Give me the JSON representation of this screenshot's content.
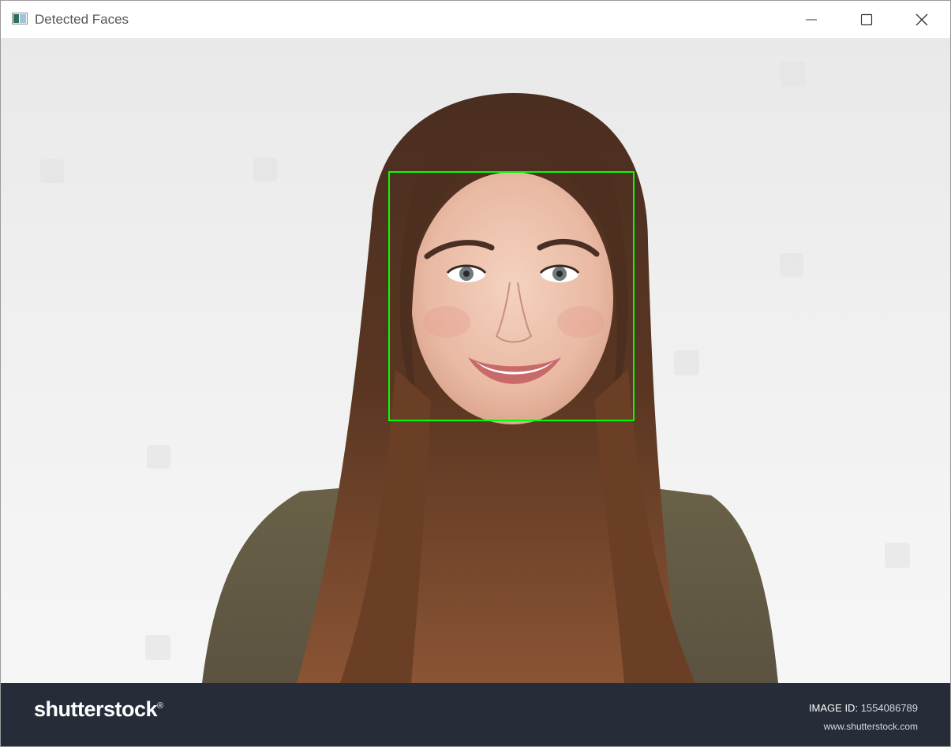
{
  "window": {
    "title": "Detected Faces",
    "icons": {
      "app": "app-window-icon",
      "minimize": "minimize-icon",
      "maximize": "maximize-icon",
      "close": "close-icon"
    }
  },
  "image": {
    "subject": "photo-of-smiling-woman",
    "detection_color": "#00ff00"
  },
  "footer": {
    "brand": "shutterstock",
    "brand_mark": "®",
    "image_id_label": "IMAGE ID:",
    "image_id_value": "1554086789",
    "site": "www.shutterstock.com",
    "background": "#262c38"
  }
}
